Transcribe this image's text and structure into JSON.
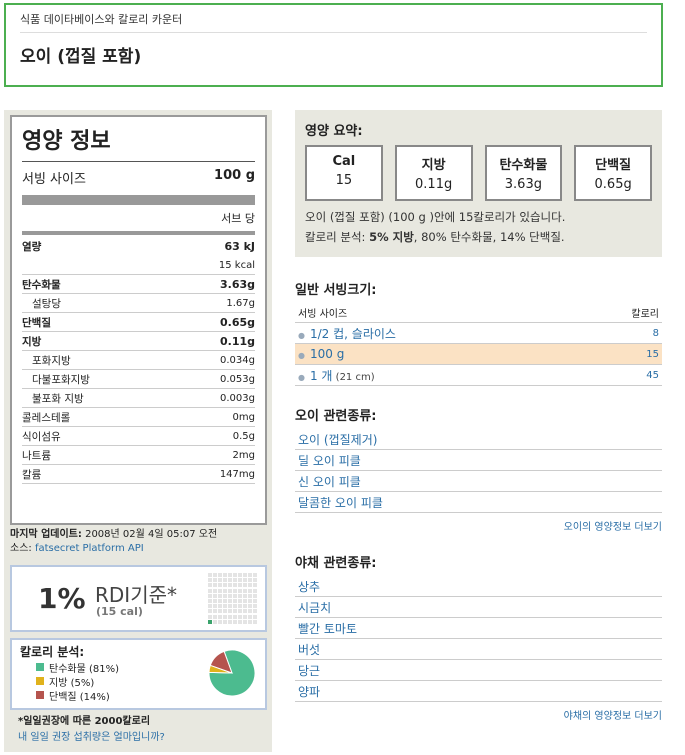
{
  "header": {
    "breadcrumb": "식품 데이타베이스와 칼로리 카운터",
    "title": "오이 (껍질 포함)"
  },
  "label": {
    "title": "영양 정보",
    "serving_label": "서빙 사이즈",
    "serving_value": "100 g",
    "per_serving": "서브 당",
    "energy_label": "열량",
    "energy_kj": "63 kJ",
    "energy_kcal": "15 kcal",
    "nutrients": [
      {
        "name": "탄수화물",
        "value": "3.63g",
        "bold": true
      },
      {
        "name": "설탕당",
        "value": "1.67g",
        "sub": true
      },
      {
        "name": "단백질",
        "value": "0.65g",
        "bold": true
      },
      {
        "name": "지방",
        "value": "0.11g",
        "bold": true
      },
      {
        "name": "포화지방",
        "value": "0.034g",
        "sub": true
      },
      {
        "name": "다불포화지방",
        "value": "0.053g",
        "sub": true
      },
      {
        "name": "불포화 지방",
        "value": "0.003g",
        "sub": true
      },
      {
        "name": "콜레스테롤",
        "value": "0mg"
      },
      {
        "name": "식이섬유",
        "value": "0.5g"
      },
      {
        "name": "나트륨",
        "value": "2mg"
      },
      {
        "name": "칼륨",
        "value": "147mg"
      }
    ]
  },
  "updated": {
    "label": "마지막 업데이트:",
    "value": "2008년 02월 4일 05:07 오전",
    "source_label": "소스:",
    "source_link": "fatsecret Platform API"
  },
  "rdi": {
    "percent": "1%",
    "label": "RDI기준*",
    "calories": "(15 cal)",
    "filled_cells": 1
  },
  "calorie_breakdown": {
    "title": "칼로리 분석:",
    "items": [
      {
        "label": "탄수화물 (81%)",
        "color": "#4cbb8f",
        "percent": 81
      },
      {
        "label": "지방 (5%)",
        "color": "#e0b21c",
        "percent": 5
      },
      {
        "label": "단백질 (14%)",
        "color": "#b5544e",
        "percent": 14
      }
    ]
  },
  "footnote": {
    "text": "*일일권장에 따른 2000칼로리",
    "link": "내 일일 권장 섭취량은 얼마입니까?"
  },
  "summary": {
    "title": "영양 요약:",
    "boxes": [
      {
        "label": "Cal",
        "value": "15"
      },
      {
        "label": "지방",
        "value": "0.11g"
      },
      {
        "label": "탄수화물",
        "value": "3.63g"
      },
      {
        "label": "단백질",
        "value": "0.65g"
      }
    ],
    "line1": "오이 (껍질 포함) (100 g )안에 15칼로리가 있습니다.",
    "line2_prefix": "칼로리 분석: ",
    "line2_bold": "5% 지방",
    "line2_rest": ", 80% 탄수화물, 14% 단백질."
  },
  "servings": {
    "title": "일반 서빙크기:",
    "col_size": "서빙 사이즈",
    "col_cal": "칼로리",
    "rows": [
      {
        "label": "1/2 컵, 슬라이스",
        "extra": "",
        "cal": "8",
        "selected": false
      },
      {
        "label": "100 g",
        "extra": "",
        "cal": "15",
        "selected": true
      },
      {
        "label": "1 개",
        "extra": " (21 cm)",
        "cal": "45",
        "selected": false
      }
    ]
  },
  "related_cucumber": {
    "title": "오이 관련종류:",
    "items": [
      "오이 (껍질제거)",
      "딜 오이 피클",
      "신 오이 피클",
      "달콤한 오이 피클"
    ],
    "more": "오이의 영양정보 더보기"
  },
  "related_veg": {
    "title": "야채 관련종류:",
    "items": [
      "상추",
      "시금치",
      "빨간 토마토",
      "버섯",
      "당근",
      "양파"
    ],
    "more": "야채의 영양정보 더보기"
  }
}
